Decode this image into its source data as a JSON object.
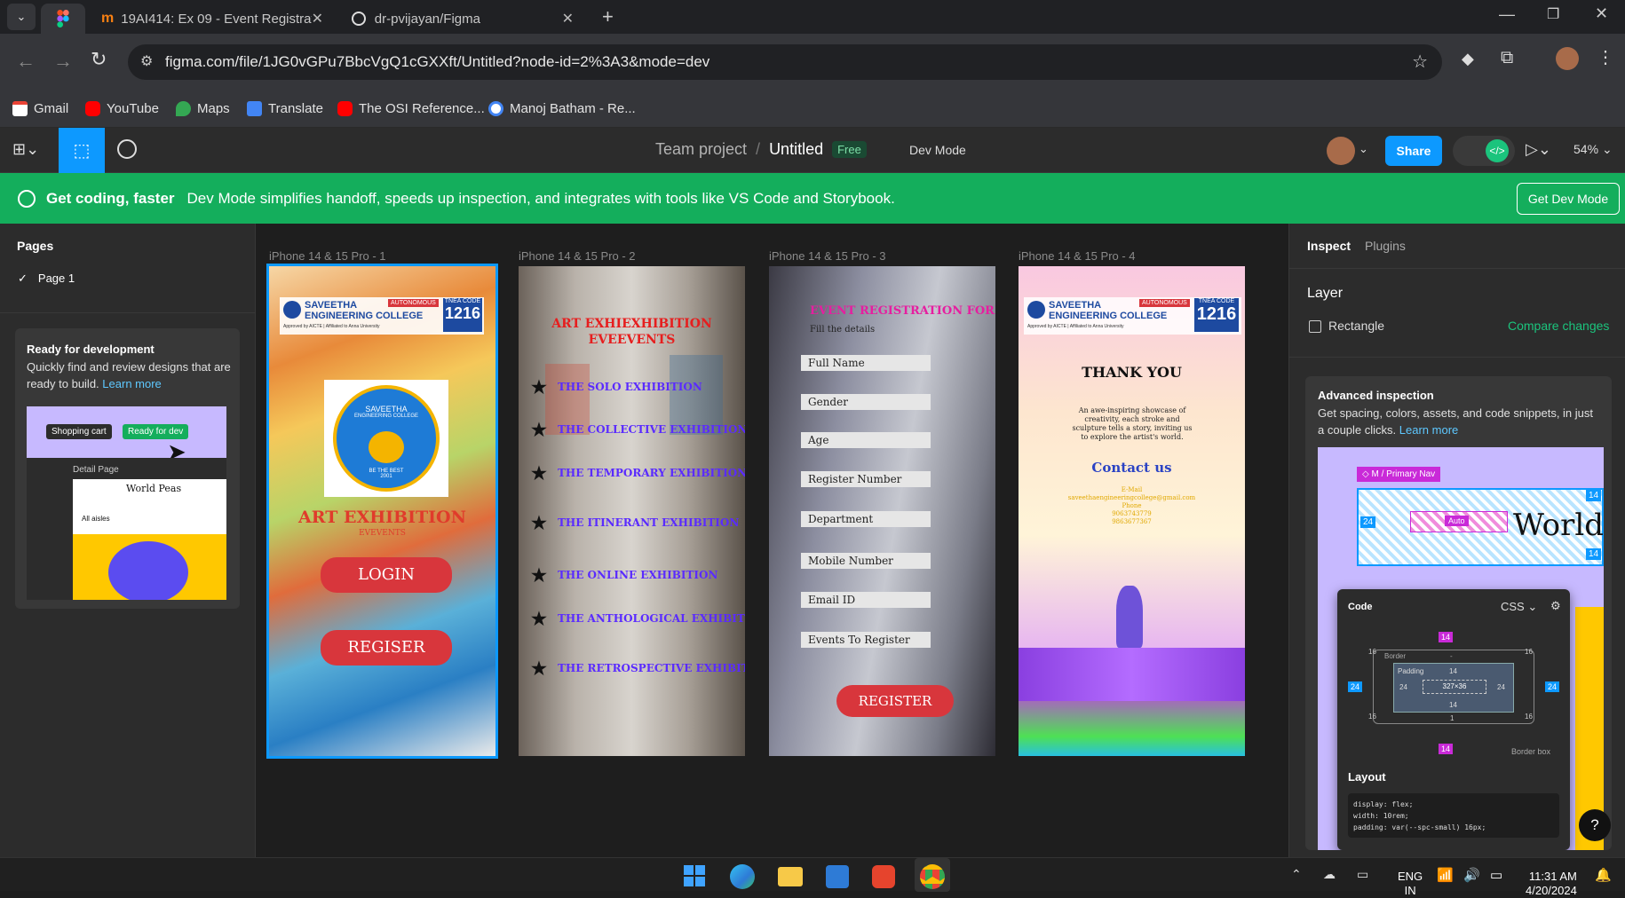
{
  "browser": {
    "tabs": [
      {
        "title": "19AI414: Ex 09 - Event Registrat",
        "icon": "moodle-icon"
      },
      {
        "title": "dr-pvijayan/Figma",
        "icon": "github-icon"
      }
    ],
    "url": "figma.com/file/1JG0vGPu7BbcVgQ1cGXXft/Untitled?node-id=2%3A3&mode=dev",
    "bookmarks": [
      "Gmail",
      "YouTube",
      "Maps",
      "Translate",
      "The OSI Reference...",
      "Manoj Batham - Re..."
    ]
  },
  "figma": {
    "breadcrumb_project": "Team project",
    "separator": "/",
    "file_name": "Untitled",
    "plan_badge": "Free",
    "mode_label": "Dev Mode",
    "share_label": "Share",
    "zoom": "54%"
  },
  "banner": {
    "title": "Get coding, faster",
    "text": "Dev Mode simplifies handoff, speeds up inspection, and integrates with tools like VS Code and Storybook.",
    "button": "Get Dev Mode"
  },
  "left_panel": {
    "pages_heading": "Pages",
    "page_item": "Page 1",
    "card_title": "Ready for development",
    "card_text": "Quickly find and review designs that are ready to build.",
    "card_link": "Learn more",
    "preview": {
      "chip_cart": "Shopping cart",
      "chip_ready": "Ready for dev",
      "detail_label": "Detail Page",
      "store_name": "World Peas",
      "aisles": "All aisles"
    }
  },
  "frames": [
    {
      "label": "iPhone 14 & 15 Pro - 1"
    },
    {
      "label": "iPhone 14 & 15 Pro - 2"
    },
    {
      "label": "iPhone 14 & 15 Pro - 3"
    },
    {
      "label": "iPhone 14 & 15 Pro - 4"
    }
  ],
  "college": {
    "name_line1": "SAVEETHA",
    "name_line2": "ENGINEERING COLLEGE",
    "autonomous": "AUTONOMOUS",
    "approval": "Approved by AICTE | Affiliated to Anna University",
    "tnea_label": "TNEA CODE",
    "tnea_code": "1216",
    "seal_top": "SAVEETHA",
    "seal_sub": "ENGINEERING COLLEGE",
    "seal_motto": "BE THE BEST",
    "seal_year": "2001"
  },
  "frame1": {
    "title": "ART EXHIBITION",
    "subtitle": "EVEVENTS",
    "login": "LOGIN",
    "register": "REGISER"
  },
  "frame2": {
    "title_line1": "ART EXHIEXHIBITION",
    "title_line2": "EVEEVENTS",
    "items": [
      "THE SOLO EXHIBITION",
      "THE COLLECTIVE EXHIBITION",
      "THE TEMPORARY EXHIBITION",
      "THE ITINERANT EXHIBITION",
      "THE ONLINE EXHIBITION",
      "THE ANTHOLOGICAL EXHIBITION",
      "THE RETROSPECTIVE EXHIBITION"
    ]
  },
  "frame3": {
    "title": "EVENT REGISTRATION FORM",
    "subtitle": "Fill the details",
    "fields": [
      "Full Name",
      "Gender",
      "Age",
      "Register Number",
      "Department",
      "Mobile Number",
      "Email ID",
      "Events To Register"
    ],
    "button": "REGISTER"
  },
  "frame4": {
    "title": "THANK YOU",
    "body": "An awe-inspiring showcase of creativity, each stroke and sculpture tells a story, inviting us to explore the artist's world.",
    "contact_heading": "Contact us",
    "email_label": "E-Mail",
    "email": "saveethaengineeringcollege@gmail.com",
    "phone_label": "Phone",
    "phone1": "9063743779",
    "phone2": "9863677367"
  },
  "right_panel": {
    "tabs": [
      "Inspect",
      "Plugins"
    ],
    "layer_heading": "Layer",
    "layer_name": "Rectangle",
    "compare": "Compare changes",
    "adv_title": "Advanced inspection",
    "adv_text": "Get spacing, colors, assets, and code snippets, in just a couple clicks.",
    "adv_link": "Learn more",
    "preview": {
      "nav_tag": "M / Primary Nav",
      "world": "World",
      "auto": "Auto",
      "n14": "14",
      "n24": "24",
      "code_label": "Code",
      "lang": "CSS",
      "border": "Border",
      "padding": "Padding",
      "dash": "-",
      "n16": "16",
      "n1": "1",
      "size": "327×36",
      "border_box": "Border box",
      "layout": "Layout",
      "code1": "display: flex;",
      "code2": "width: 10rem;",
      "code3": "padding: var(--spc-small) 16px;"
    }
  },
  "help": "?",
  "taskbar": {
    "lang": "ENG",
    "lang2": "IN",
    "time": "11:31 AM",
    "date": "4/20/2024"
  },
  "colors": {
    "figma_green": "#14ae5c",
    "share_blue": "#0d99ff",
    "dev_green": "#1bc47d",
    "accent_purple": "#5a2bff",
    "register_red": "#d8363c"
  }
}
